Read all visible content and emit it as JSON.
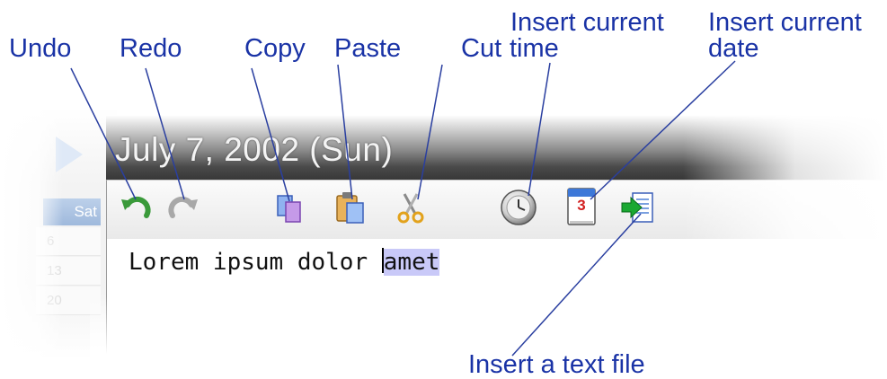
{
  "window": {
    "title": "July 7, 2002 (Sun)"
  },
  "calendar": {
    "header_day": "Sat",
    "dates": [
      "6",
      "13",
      "20"
    ]
  },
  "editor": {
    "text_before_caret": "Lorem ipsum dolor ",
    "selected_text": "amet"
  },
  "toolbar": {
    "buttons": [
      {
        "name": "undo",
        "icon": "undo-arrow-icon"
      },
      {
        "name": "redo",
        "icon": "redo-arrow-icon"
      },
      {
        "name": "copy",
        "icon": "copy-documents-icon"
      },
      {
        "name": "paste",
        "icon": "clipboard-icon"
      },
      {
        "name": "cut",
        "icon": "scissors-icon"
      },
      {
        "name": "insert-time",
        "icon": "clock-icon"
      },
      {
        "name": "insert-date",
        "icon": "calendar-page-icon"
      },
      {
        "name": "insert-text-file",
        "icon": "document-arrow-icon"
      }
    ],
    "calendar_icon_digit": "3"
  },
  "callouts": {
    "undo": "Undo",
    "redo": "Redo",
    "copy": "Copy",
    "paste": "Paste",
    "cut": "Cut",
    "insert_time": [
      "Insert current",
      "time"
    ],
    "insert_date": [
      "Insert current",
      "date"
    ],
    "insert_text_file": "Insert a text file"
  },
  "colors": {
    "callout_text": "#1a33a6",
    "leader_line": "#2a3fa0",
    "selection": "#c9c9f8",
    "titlebar_dark": "#383838",
    "undo_green": "#3a9a3a"
  }
}
